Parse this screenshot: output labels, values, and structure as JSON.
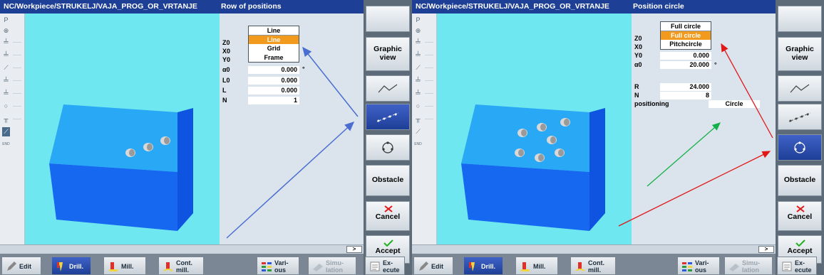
{
  "left": {
    "title_path": "NC/Workpiece/STRUKELJ/VAJA_PROG_OR_VRTANJE",
    "cycle_title": "Row of positions",
    "dropdown": {
      "header": "Line",
      "options": [
        "Line",
        "Grid",
        "Frame"
      ],
      "selected": "Line"
    },
    "fields": [
      {
        "label": "Z0",
        "value": "",
        "unit": ""
      },
      {
        "label": "X0",
        "value": "",
        "unit": ""
      },
      {
        "label": "Y0",
        "value": "",
        "unit": ""
      },
      {
        "label": "α0",
        "value": "0.000",
        "unit": "°"
      },
      {
        "label": "L0",
        "value": "0.000",
        "unit": ""
      },
      {
        "label": "L",
        "value": "0.000",
        "unit": ""
      },
      {
        "label": "N",
        "value": "1",
        "unit": ""
      }
    ],
    "scroll_label": ">"
  },
  "right": {
    "title_path": "NC/Workpiece/STRUKELJ/VAJA_PROG_OR_VRTANJE",
    "cycle_title": "Position circle",
    "dropdown": {
      "header": "Full circle",
      "options": [
        "Full circle",
        "Pitchcircle"
      ],
      "selected": "Full circle"
    },
    "fields": [
      {
        "label": "Z0",
        "value": "",
        "unit": ""
      },
      {
        "label": "X0",
        "value": "",
        "unit": ""
      },
      {
        "label": "Y0",
        "value": "0.000",
        "unit": ""
      },
      {
        "label": "α0",
        "value": "20.000",
        "unit": "°"
      },
      {
        "label": "R",
        "value": "24.000",
        "unit": ""
      },
      {
        "label": "N",
        "value": "8",
        "unit": ""
      }
    ],
    "positioning_label": "positioning",
    "positioning_value": "Circle",
    "scroll_label": ">"
  },
  "vertical_softkeys": {
    "graphic_view": "Graphic view",
    "obstacle": "Obstacle",
    "cancel": "Cancel",
    "accept": "Accept"
  },
  "horizontal_softkeys": {
    "edit": "Edit",
    "drill": "Drill.",
    "mill": "Mill.",
    "cont_mill_1": "Cont.",
    "cont_mill_2": "mill.",
    "various_1": "Vari-",
    "various_2": "ous",
    "simulation_1": "Simu-",
    "simulation_2": "lation",
    "execute_1": "Ex-",
    "execute_2": "ecute"
  },
  "sidebar_icons": [
    "P",
    "⊕",
    "╧",
    "╧",
    "⟋",
    "╧",
    "╧",
    "○",
    "╥",
    "⟋",
    "END"
  ],
  "colors": {
    "title_bar": "#1e3f96",
    "viewport": "#6fe7f0",
    "block_top": "#29a8f5",
    "block_side": "#1668f0",
    "selection": "#f29a1e",
    "arrow_blue": "#4a6ed0",
    "arrow_red": "#e01818",
    "arrow_green": "#14b04a"
  }
}
